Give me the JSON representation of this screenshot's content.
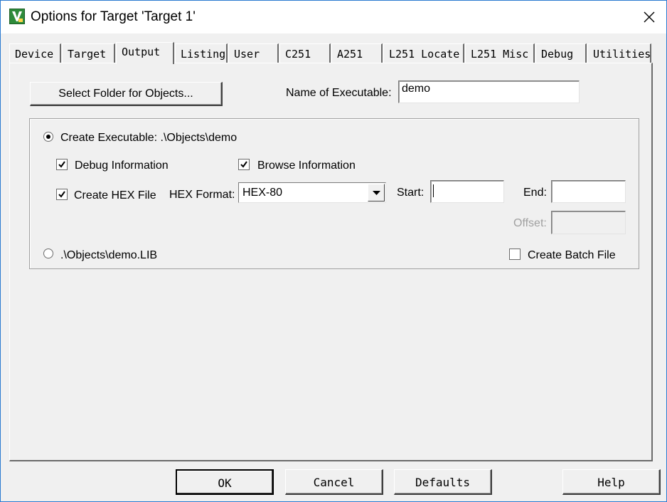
{
  "window": {
    "title": "Options for Target 'Target 1'",
    "app_icon": "keil-uvision-icon",
    "close_icon": "close-icon"
  },
  "tabs": [
    {
      "label": "Device",
      "active": false
    },
    {
      "label": "Target",
      "active": false
    },
    {
      "label": "Output",
      "active": true
    },
    {
      "label": "Listing",
      "active": false
    },
    {
      "label": "User",
      "active": false
    },
    {
      "label": "C251",
      "active": false
    },
    {
      "label": "A251",
      "active": false
    },
    {
      "label": "L251 Locate",
      "active": false
    },
    {
      "label": "L251 Misc",
      "active": false
    },
    {
      "label": "Debug",
      "active": false
    },
    {
      "label": "Utilities",
      "active": false
    }
  ],
  "output": {
    "select_folder_label": "Select Folder for Objects...",
    "name_exe_label": "Name of Executable:",
    "name_exe_value": "demo",
    "create_exe_label": "Create Executable:  .\\Objects\\demo",
    "create_exe_selected": true,
    "debug_info_label": "Debug Information",
    "debug_info_checked": true,
    "browse_info_label": "Browse Information",
    "browse_info_checked": true,
    "create_hex_label": "Create HEX File",
    "create_hex_checked": true,
    "hex_format_label": "HEX Format:",
    "hex_format_value": "HEX-80",
    "start_label": "Start:",
    "start_value": "",
    "end_label": "End:",
    "end_value": "",
    "offset_label": "Offset:",
    "offset_value": "",
    "lib_label": ".\\Objects\\demo.LIB",
    "lib_selected": false,
    "batch_label": "Create Batch File",
    "batch_checked": false
  },
  "footer": {
    "ok": "OK",
    "cancel": "Cancel",
    "defaults": "Defaults",
    "help": "Help"
  }
}
